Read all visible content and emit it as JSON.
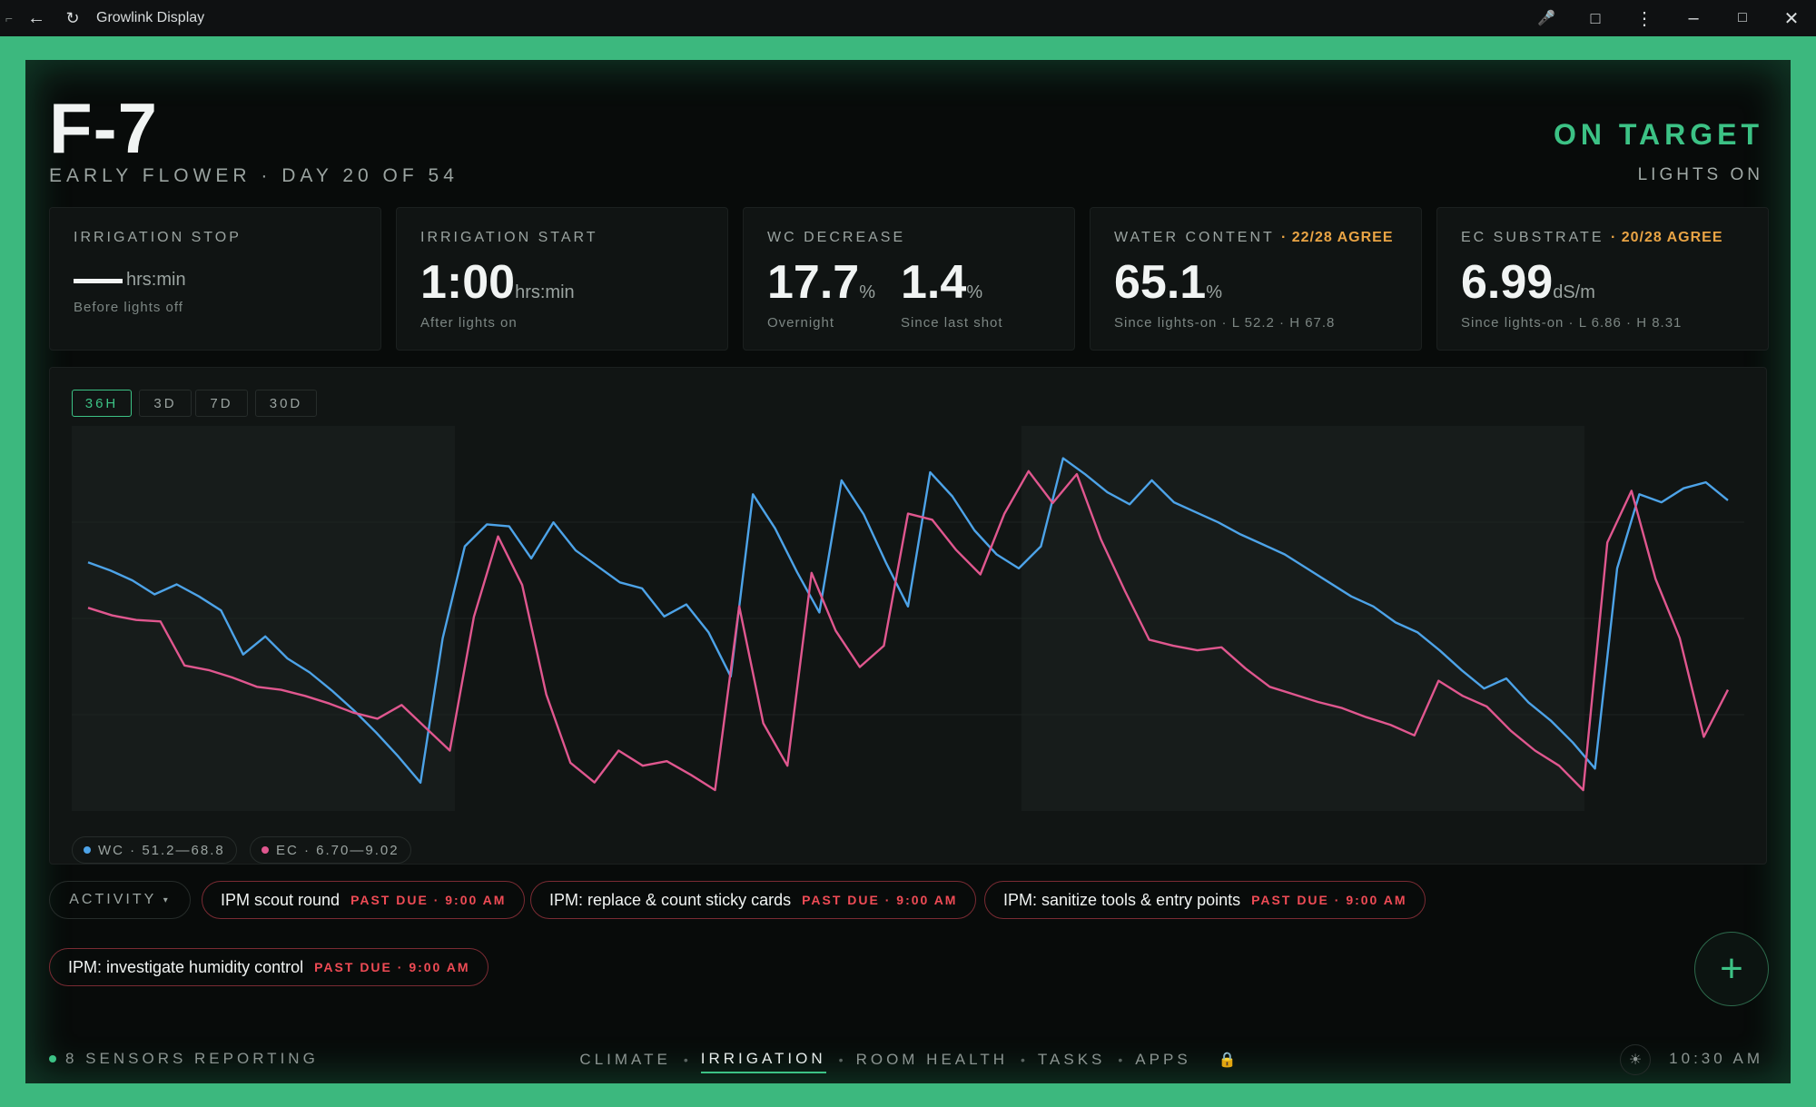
{
  "window": {
    "title": "Growlink Display"
  },
  "header": {
    "room": "F-7",
    "stage": "EARLY FLOWER · DAY 20 OF 54",
    "status": "ON TARGET",
    "lights": "LIGHTS ON"
  },
  "cards": {
    "irrigation_stop": {
      "label": "IRRIGATION STOP",
      "unit": "hrs:min",
      "sub": "Before lights off"
    },
    "irrigation_start": {
      "label": "IRRIGATION START",
      "value": "1:00",
      "unit": "hrs:min",
      "sub": "After lights on"
    },
    "wc_decrease": {
      "label": "WC DECREASE",
      "value1": "17.7",
      "unit1": "%",
      "sub1": "Overnight",
      "value2": "1.4",
      "unit2": "%",
      "sub2": "Since last shot"
    },
    "water_content": {
      "label": "WATER CONTENT",
      "agree": "· 22/28 AGREE",
      "value": "65.1",
      "unit": "%",
      "sub": "Since lights-on · L 52.2 · H 67.8"
    },
    "ec_substrate": {
      "label": "EC SUBSTRATE",
      "agree": "· 20/28 AGREE",
      "value": "6.99",
      "unit": "dS/m",
      "sub": "Since lights-on · L 6.86 · H 8.31"
    }
  },
  "chart": {
    "ranges": [
      "36H",
      "3D",
      "7D",
      "30D"
    ],
    "active_range": "36H",
    "legend": {
      "wc": "WC · 51.2—68.8",
      "ec": "EC · 6.70—9.02"
    }
  },
  "chart_data": {
    "type": "line",
    "series": [
      {
        "name": "WC",
        "color": "#4da3e8",
        "values": [
          62.8,
          62.4,
          61.9,
          61.2,
          61.7,
          61.1,
          60.4,
          58.2,
          59.1,
          58.0,
          57.3,
          56.4,
          55.4,
          54.3,
          53.1,
          51.8,
          59.0,
          63.6,
          64.7,
          64.6,
          63.0,
          64.8,
          63.4,
          62.6,
          61.8,
          61.5,
          60.1,
          60.7,
          59.3,
          57.1,
          66.2,
          64.5,
          62.3,
          60.3,
          66.9,
          65.2,
          62.8,
          60.6,
          67.3,
          66.1,
          64.4,
          63.2,
          62.5,
          63.6,
          68.0,
          67.2,
          66.3,
          65.7,
          66.9,
          65.8,
          65.3,
          64.8,
          64.2,
          63.7,
          63.2,
          62.5,
          61.8,
          61.1,
          60.6,
          59.8,
          59.3,
          58.4,
          57.4,
          56.5,
          57.0,
          55.8,
          54.9,
          53.8,
          52.5,
          62.5,
          66.2,
          65.8,
          66.5,
          66.8,
          65.9
        ]
      },
      {
        "name": "EC",
        "color": "#e0578f",
        "values": [
          7.93,
          7.88,
          7.85,
          7.84,
          7.55,
          7.52,
          7.47,
          7.41,
          7.39,
          7.35,
          7.3,
          7.24,
          7.2,
          7.29,
          7.14,
          6.99,
          7.87,
          8.4,
          8.08,
          7.36,
          6.91,
          6.78,
          6.99,
          6.89,
          6.92,
          6.83,
          6.73,
          7.94,
          7.17,
          6.89,
          8.16,
          7.78,
          7.54,
          7.68,
          8.55,
          8.51,
          8.31,
          8.15,
          8.55,
          8.83,
          8.62,
          8.81,
          8.38,
          8.04,
          7.72,
          7.68,
          7.65,
          7.67,
          7.53,
          7.41,
          7.36,
          7.31,
          7.27,
          7.21,
          7.16,
          7.09,
          7.45,
          7.35,
          7.28,
          7.12,
          6.99,
          6.89,
          6.73,
          8.36,
          8.7,
          8.12,
          7.73,
          7.08,
          7.39
        ]
      },
      {
        "name": "EC-tail",
        "color": "#e0578f",
        "values": []
      }
    ],
    "wc_range": [
      51.2,
      68.8
    ],
    "ec_range": [
      6.7,
      9.02
    ],
    "grid": true
  },
  "activity": {
    "label": "ACTIVITY",
    "tasks": [
      {
        "name": "IPM scout round",
        "due": "PAST DUE · 9:00 AM"
      },
      {
        "name": "IPM: replace & count sticky cards",
        "due": "PAST DUE · 9:00 AM"
      },
      {
        "name": "IPM: sanitize tools & entry points",
        "due": "PAST DUE · 9:00 AM"
      },
      {
        "name": "IPM: investigate humidity control",
        "due": "PAST DUE · 9:00 AM"
      }
    ]
  },
  "footer": {
    "sensors": "8 SENSORS REPORTING",
    "nav": [
      "CLIMATE",
      "IRRIGATION",
      "ROOM HEALTH",
      "TASKS",
      "APPS"
    ],
    "active_nav": "IRRIGATION",
    "time": "10:30 AM"
  }
}
